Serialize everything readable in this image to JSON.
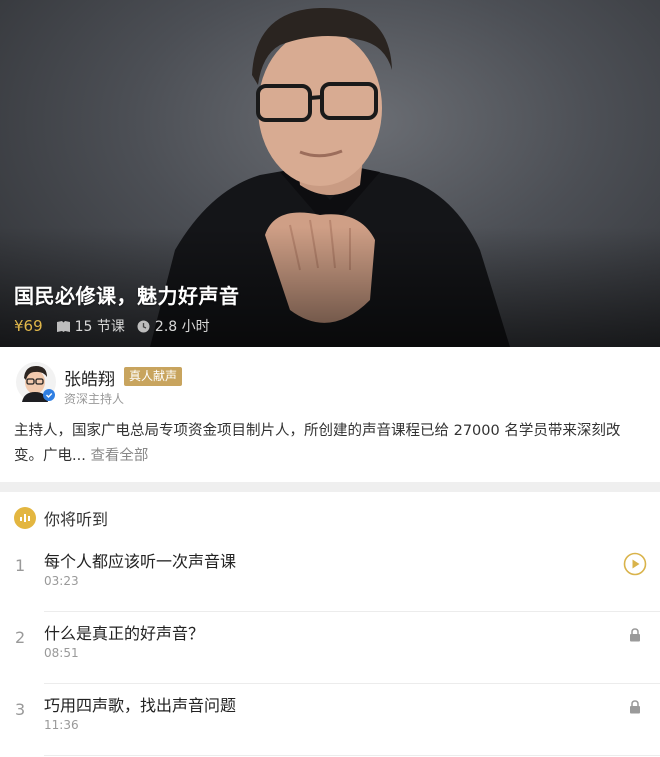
{
  "hero": {
    "title": "国民必修课，魅力好声音",
    "price": "¥69",
    "lessons_count": "15 节课",
    "duration": "2.8 小时"
  },
  "author": {
    "name": "张皓翔",
    "badge": "真人献声",
    "role": "资深主持人",
    "description": "主持人，国家广电总局专项资金项目制片人，所创建的声音课程已给 27000 名学员带来深刻改变。广电...",
    "see_all": "查看全部"
  },
  "section": {
    "title": "你将听到"
  },
  "lessons": [
    {
      "num": "1",
      "title": "每个人都应该听一次声音课",
      "duration": "03:23",
      "icon": "play-circle-icon"
    },
    {
      "num": "2",
      "title": "什么是真正的好声音？",
      "duration": "08:51",
      "icon": "lock-icon"
    },
    {
      "num": "3",
      "title": "巧用四声歌，找出声音问题",
      "duration": "11:36",
      "icon": "lock-icon"
    }
  ],
  "colors": {
    "price": "#e0b74a",
    "badge_bg": "#c8a45e",
    "section_icon": "#e3b640",
    "play_icon": "#d9b34a"
  }
}
